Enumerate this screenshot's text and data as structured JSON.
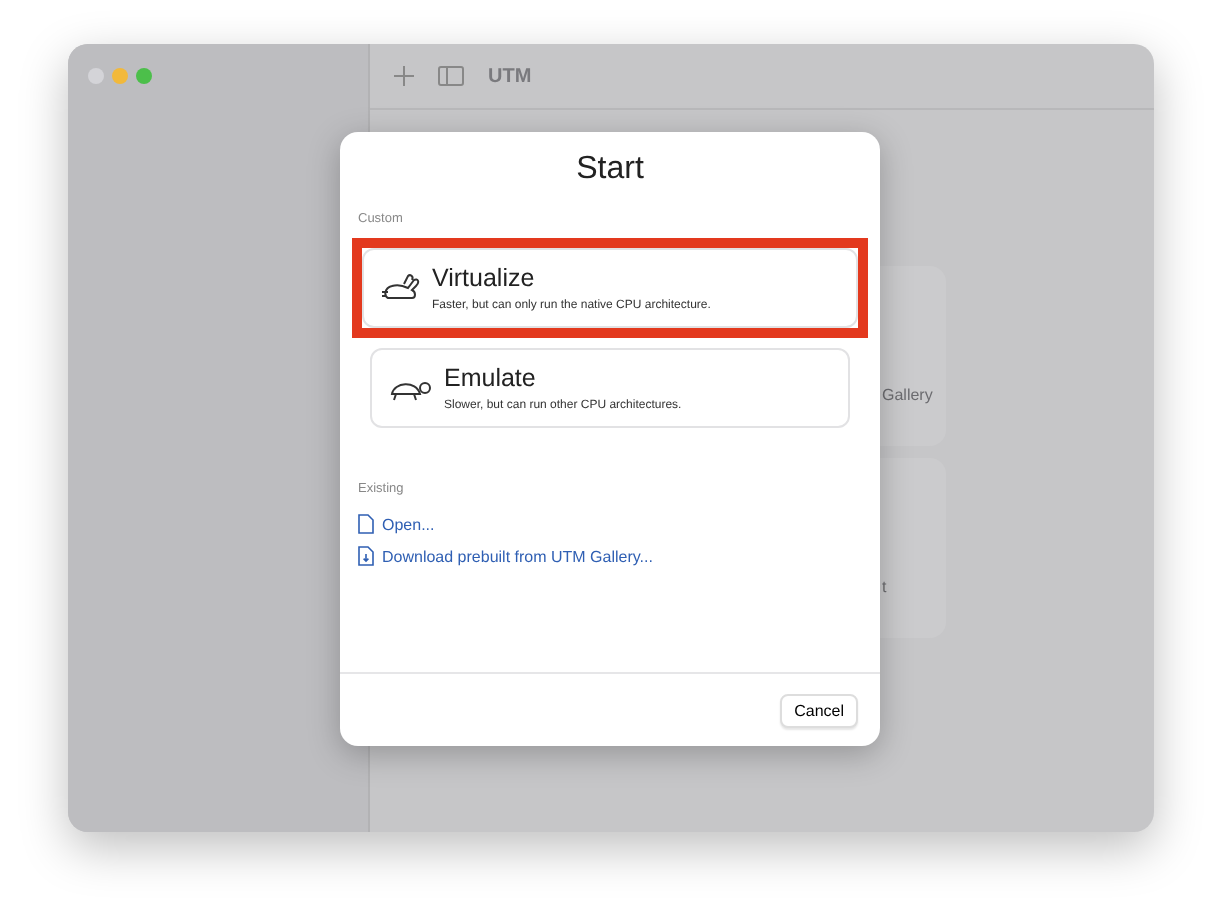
{
  "window": {
    "title": "UTM",
    "traffic_lights": [
      {
        "color": "#d4d4d8"
      },
      {
        "color": "#f2b93b"
      },
      {
        "color": "#4cbf4a"
      }
    ]
  },
  "background_cards": [
    {
      "label": "Gallery"
    },
    {
      "label": "t"
    }
  ],
  "dialog": {
    "title": "Start",
    "sections": [
      {
        "heading": "Custom",
        "options": [
          {
            "kind": "rabbit",
            "title": "Virtualize",
            "subtitle": "Faster, but can only run the native CPU architecture.",
            "highlighted": true
          },
          {
            "kind": "turtle",
            "title": "Emulate",
            "subtitle": "Slower, but can run other CPU architectures.",
            "highlighted": false
          }
        ]
      },
      {
        "heading": "Existing",
        "links": [
          {
            "kind": "file",
            "label": "Open..."
          },
          {
            "kind": "download",
            "label": "Download prebuilt from UTM Gallery..."
          }
        ]
      }
    ],
    "buttons": [
      "Cancel"
    ]
  }
}
